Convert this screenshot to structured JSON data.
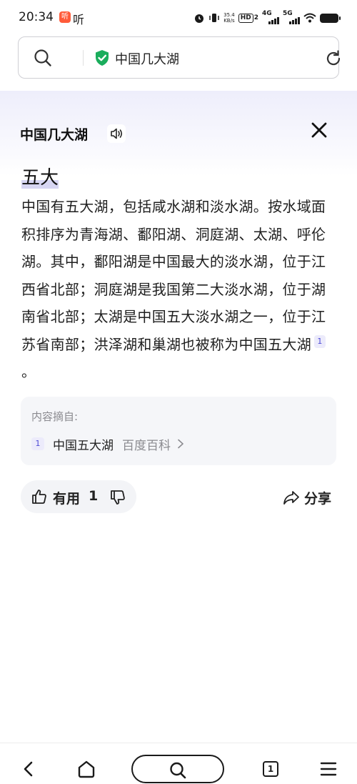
{
  "status_bar": {
    "time": "20:34",
    "app_badge": "听",
    "listen": "听",
    "net_speed_value": "35.4",
    "net_speed_unit": "KB/s",
    "hd_badge": "HD",
    "hd_sub": "2",
    "sig1_label": "4G",
    "sig2_label": "5G"
  },
  "search_bar": {
    "query": "中国几大湖"
  },
  "card": {
    "title": "中国几大湖",
    "answer_big": "五大",
    "answer_body": "中国有五大湖，包括咸水湖和淡水湖。按水域面积排序为青海湖、鄱阳湖、洞庭湖、太湖、呼伦湖。其中，鄱阳湖是中国最大的淡水湖，位于江西省北部；洞庭湖是我国第二大淡水湖，位于湖南省北部；太湖是中国五大淡水湖之一，位于江苏省南部；洪泽湖和巢湖也被称为中国五大湖",
    "citation_num": "1",
    "answer_end": "。",
    "source": {
      "label": "内容摘自:",
      "num": "1",
      "title": "中国五大湖",
      "site": "百度百科"
    },
    "feedback": {
      "useful_label": "有用",
      "useful_count": "1"
    },
    "share_label": "分享"
  },
  "bottom_nav": {
    "tabs_count": "1"
  },
  "colors": {
    "accent": "#4e4bd6",
    "shield_green": "#1aad5c",
    "highlight": "#d7d6f3"
  }
}
